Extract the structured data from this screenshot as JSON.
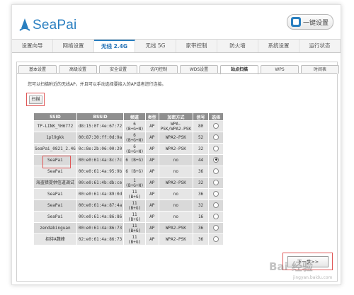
{
  "brand": {
    "name": "SeaPai",
    "accent": "#2a7fc0"
  },
  "quick_setup_label": "一键设置",
  "main_nav": [
    {
      "label": "设置向导"
    },
    {
      "label": "网络设置"
    },
    {
      "label": "无线 2.4G",
      "active": true
    },
    {
      "label": "无线 5G"
    },
    {
      "label": "家带控制"
    },
    {
      "label": "防火墙"
    },
    {
      "label": "系统设置"
    },
    {
      "label": "运行状态"
    }
  ],
  "sub_nav": [
    {
      "label": "基本设置"
    },
    {
      "label": "高级设置"
    },
    {
      "label": "安全设置"
    },
    {
      "label": "访问控制"
    },
    {
      "label": "WDS设置"
    },
    {
      "label": "站点扫描",
      "active": true
    },
    {
      "label": "WPS"
    },
    {
      "label": "时间表"
    }
  ],
  "hint": "您可以扫描附近的无线AP，并且可以手动选择要接入的AP或者进行连接。",
  "scan_label": "扫描",
  "table": {
    "headers": [
      "SSID",
      "BSSID",
      "频道",
      "类型",
      "加密方式",
      "信号",
      "选择"
    ],
    "rows": [
      {
        "ssid": "TP-LINK_YH6772",
        "bssid": "d8:15:0f:4e:67:72",
        "channel": "6 (B+G+N)",
        "type": "AP",
        "encrypt": "WPA-PSK/WPA2-PSK",
        "signal": "80",
        "selected": false
      },
      {
        "ssid": "1pl9gkk",
        "bssid": "00:87:30:ff:0d:9a",
        "channel": "6 (B+G+N)",
        "type": "AP",
        "encrypt": "WPA2-PSK",
        "signal": "52",
        "selected": false
      },
      {
        "ssid": "SeaPai_0821_2.4G",
        "bssid": "0c:8e:2b:06:00:20",
        "channel": "6 (B+G+N)",
        "type": "AP",
        "encrypt": "WPA2-PSK",
        "signal": "32",
        "selected": false
      },
      {
        "ssid": "SeaPai",
        "bssid": "00:e0:61:4a:8c:7c",
        "channel": "6 (B+G)",
        "type": "AP",
        "encrypt": "no",
        "signal": "44",
        "selected": true
      },
      {
        "ssid": "SeaPai",
        "bssid": "00:e0:61:4a:95:9b",
        "channel": "6 (B+G)",
        "type": "AP",
        "encrypt": "no",
        "signal": "36",
        "selected": false
      },
      {
        "ssid": "海盗猎提供信道调试",
        "bssid": "00:e0:61:4b:db:ce",
        "channel": "1 (B+G+N)",
        "type": "AP",
        "encrypt": "WPA2-PSK",
        "signal": "32",
        "selected": false
      },
      {
        "ssid": "SeaPai",
        "bssid": "00:e0:61:4a:89:0d",
        "channel": "11 (B+G)",
        "type": "AP",
        "encrypt": "no",
        "signal": "36",
        "selected": false
      },
      {
        "ssid": "SeaPai",
        "bssid": "00:e0:61:4a:87:4a",
        "channel": "11 (B+G)",
        "type": "AP",
        "encrypt": "no",
        "signal": "32",
        "selected": false
      },
      {
        "ssid": "SeaPai",
        "bssid": "00:e0:61:4a:86:86",
        "channel": "11 (B+G)",
        "type": "AP",
        "encrypt": "no",
        "signal": "16",
        "selected": false
      },
      {
        "ssid": "zendabinguan",
        "bssid": "00:e0:61:4a:86:73",
        "channel": "11 (B+G)",
        "type": "AP",
        "encrypt": "WPA2-PSK",
        "signal": "36",
        "selected": false
      },
      {
        "ssid": "招待A魏峰",
        "bssid": "02:e0:61:4a:86:73",
        "channel": "11 (B+G)",
        "type": "AP",
        "encrypt": "WPA2-PSK",
        "signal": "36",
        "selected": false
      }
    ]
  },
  "next_label": "下一步>>",
  "watermark": {
    "main": "Bai 经验",
    "sub": "jingyan.baidu.com"
  }
}
